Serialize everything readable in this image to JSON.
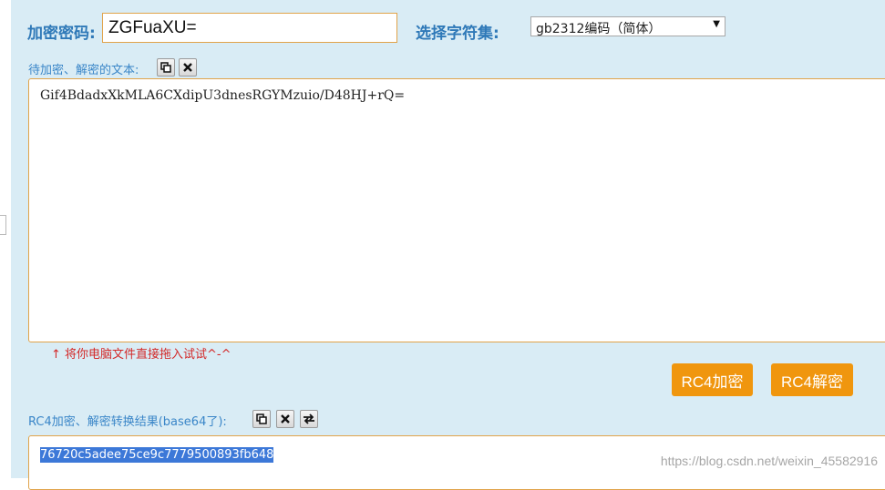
{
  "key": {
    "label": "加密密码:",
    "value": "ZGFuaXU="
  },
  "charset": {
    "label": "选择字符集:",
    "selected": "gb2312编码（简体）"
  },
  "input_area": {
    "label": "待加密、解密的文本:",
    "content": "Gif4BdadxXkMLA6CXdipU3dnesRGYMzuio/D48HJ+rQ=",
    "drag_hint": "↑ 将你电脑文件直接拖入试试^-^"
  },
  "buttons": {
    "encrypt": "RC4加密",
    "decrypt": "RC4解密"
  },
  "result": {
    "label": "RC4加密、解密转换结果(base64了):",
    "content": "76720c5adee75ce9c7779500893fb648"
  },
  "watermark": "https://blog.csdn.net/weixin_45582916",
  "colors": {
    "accent_orange": "#f0960e",
    "label_blue": "#2f79b8",
    "panel_bg": "#d9ecf5",
    "hint_red": "#d32828"
  }
}
